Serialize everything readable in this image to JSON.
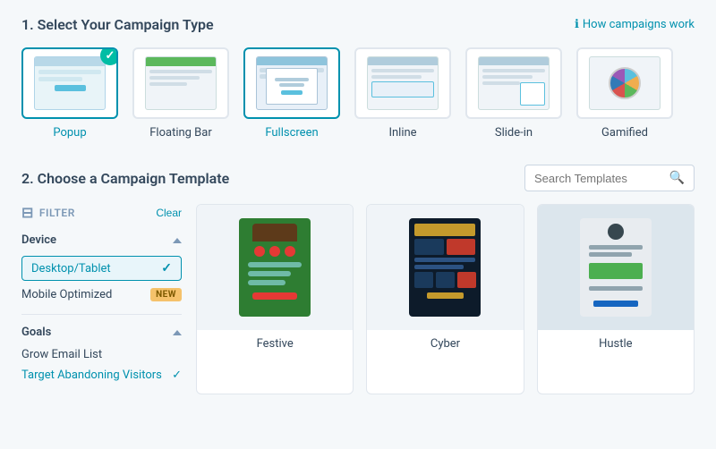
{
  "section1": {
    "title": "1. Select Your Campaign Type",
    "how_it_works": "How campaigns work",
    "campaign_types": [
      {
        "id": "popup",
        "label": "Popup",
        "selected": true
      },
      {
        "id": "floating-bar",
        "label": "Floating Bar",
        "selected": false
      },
      {
        "id": "fullscreen",
        "label": "Fullscreen",
        "selected": false
      },
      {
        "id": "inline",
        "label": "Inline",
        "selected": false
      },
      {
        "id": "slide-in",
        "label": "Slide-in",
        "selected": false
      },
      {
        "id": "gamified",
        "label": "Gamified",
        "selected": false
      }
    ]
  },
  "section2": {
    "title": "2. Choose a Campaign Template",
    "search_placeholder": "Search Templates",
    "filter": {
      "label": "FILTER",
      "clear_label": "Clear",
      "device_section": {
        "title": "Device",
        "options": [
          {
            "label": "Desktop/Tablet",
            "active": true
          },
          {
            "label": "Mobile Optimized",
            "active": false,
            "badge": "NEW"
          }
        ]
      },
      "goals_section": {
        "title": "Goals",
        "options": [
          {
            "label": "Grow Email List",
            "selected": false
          },
          {
            "label": "Target Abandoning Visitors",
            "selected": true
          }
        ]
      }
    },
    "templates": [
      {
        "name": "Festive"
      },
      {
        "name": "Cyber"
      },
      {
        "name": "Hustle"
      }
    ]
  },
  "icons": {
    "info": "ℹ",
    "check": "✓",
    "search": "🔍",
    "filter": "≡",
    "chevron_up": "^"
  }
}
